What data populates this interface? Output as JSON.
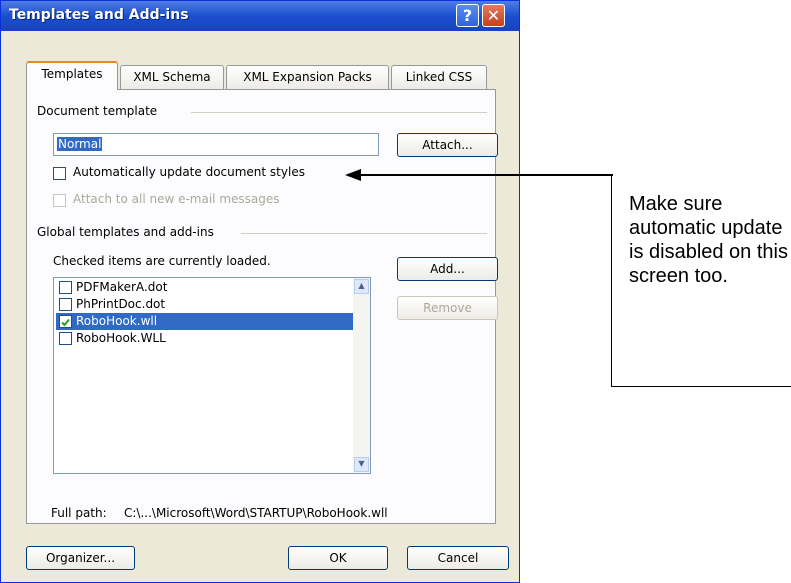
{
  "dialog": {
    "title": "Templates and Add-ins",
    "help_symbol": "?",
    "close_symbol": "✕"
  },
  "tabs": [
    {
      "label": "Templates",
      "active": true
    },
    {
      "label": "XML Schema",
      "active": false
    },
    {
      "label": "XML Expansion Packs",
      "active": false
    },
    {
      "label": "Linked CSS",
      "active": false
    }
  ],
  "document_template": {
    "group_label": "Document template",
    "value": "Normal",
    "attach_label": "Attach...",
    "auto_update_label": "Automatically update document styles",
    "auto_update_checked": false,
    "attach_email_label": "Attach to all new e-mail messages",
    "attach_email_enabled": false
  },
  "global_templates": {
    "group_label": "Global templates and add-ins",
    "info": "Checked items are currently loaded.",
    "items": [
      {
        "label": "PDFMakerA.dot",
        "checked": false,
        "selected": false
      },
      {
        "label": "PhPrintDoc.dot",
        "checked": false,
        "selected": false
      },
      {
        "label": "RoboHook.wll",
        "checked": true,
        "selected": true
      },
      {
        "label": "RoboHook.WLL",
        "checked": false,
        "selected": false
      }
    ],
    "add_label": "Add...",
    "remove_label": "Remove",
    "full_path_label": "Full path:",
    "full_path_value": "C:\\...\\Microsoft\\Word\\STARTUP\\RoboHook.wll"
  },
  "footer": {
    "organizer_label": "Organizer...",
    "ok_label": "OK",
    "cancel_label": "Cancel"
  },
  "annotation": {
    "text": "Make sure automatic update is disabled on this screen too."
  },
  "colors": {
    "titlebar": "#1b4fcf",
    "dialog_bg": "#ece9d8",
    "selection": "#316ac5",
    "tab_highlight": "#e68b2c"
  }
}
